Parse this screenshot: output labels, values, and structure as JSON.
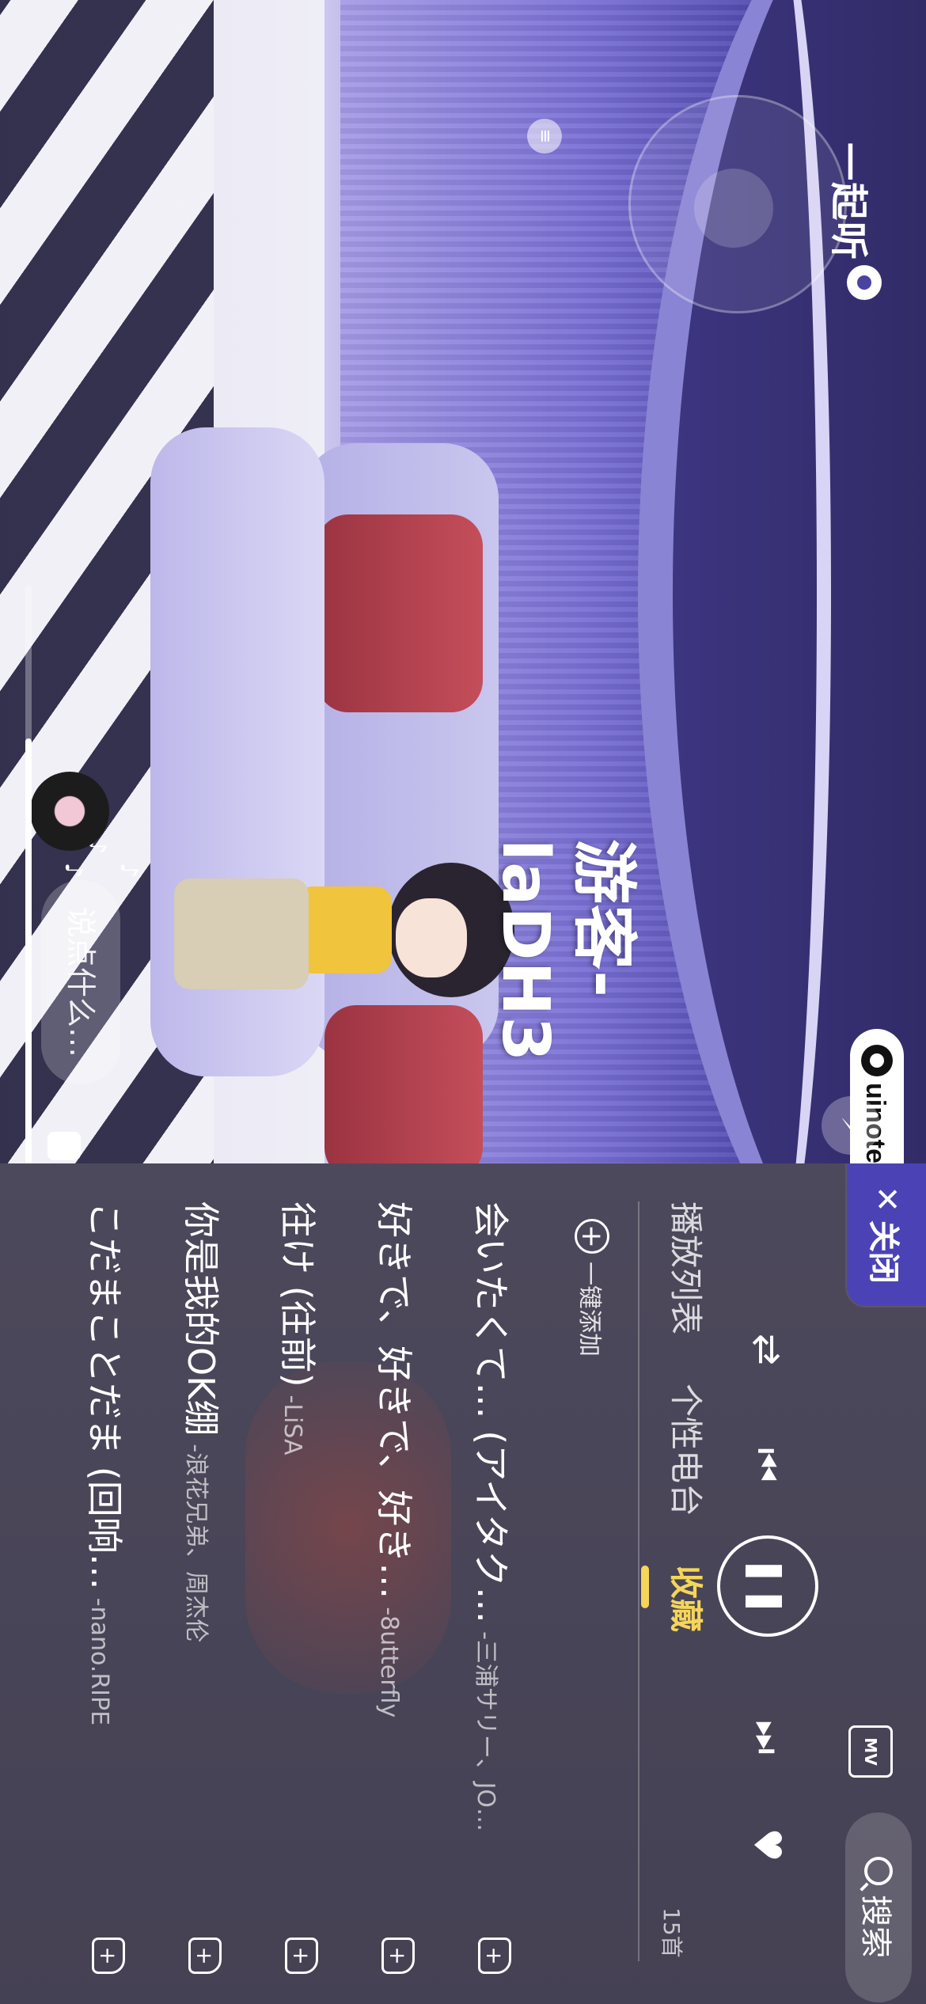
{
  "watermark": {
    "text": "uinotes.com"
  },
  "room": {
    "title": "一起听",
    "username": "游客-laDH3"
  },
  "chat": {
    "placeholder": "说点什么…"
  },
  "panel": {
    "close_label": "关闭",
    "search_label": "搜索",
    "mv_label": "MV",
    "tabs": [
      {
        "label": "播放列表",
        "active": false
      },
      {
        "label": "个性电台",
        "active": false
      },
      {
        "label": "收藏",
        "active": true
      }
    ],
    "add_all_label": "一键添加",
    "count": "15首",
    "songs": [
      {
        "title": "会いたくて… (アイタク…",
        "artist": "-三浦サリー、JO…"
      },
      {
        "title": "好きで、好きで、好き…",
        "artist": "-8utterfly"
      },
      {
        "title": "往け (往前)",
        "artist": "-LiSA"
      },
      {
        "title": "你是我的OK绷",
        "artist": "-浪花兄弟、周杰伦"
      },
      {
        "title": "こだまことだま (回响…",
        "artist": "-nano.RIPE"
      }
    ]
  },
  "playback": {
    "progress": 0.77
  },
  "colors": {
    "accent": "#f5d55a",
    "close_tab": "#4b43b5"
  },
  "icons": [
    "repeat-icon",
    "previous-icon",
    "pause-icon",
    "next-icon",
    "heart-icon",
    "search-icon",
    "mv-icon",
    "add-to-playlist-icon",
    "settings-icon",
    "joystick-icon",
    "gift-icon",
    "flash-icon"
  ]
}
